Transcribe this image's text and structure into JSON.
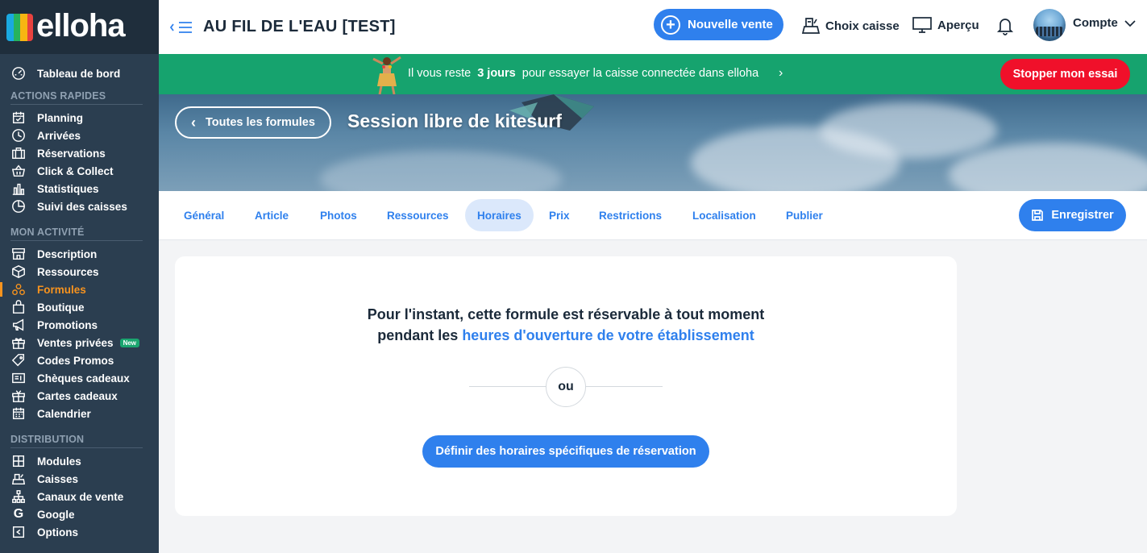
{
  "brand": {
    "logo_text": "elloha",
    "logo_colors": [
      "#1aa9e1",
      "#27b35e",
      "#f7b512",
      "#e8423f"
    ]
  },
  "sidebar": {
    "dashboard": "Tableau de bord",
    "sections": [
      {
        "title": "ACTIONS RAPIDES",
        "items": [
          {
            "label": "Planning",
            "icon": "calendar-check-icon"
          },
          {
            "label": "Arrivées",
            "icon": "clock-icon"
          },
          {
            "label": "Réservations",
            "icon": "suitcase-icon"
          },
          {
            "label": "Click & Collect",
            "icon": "basket-icon"
          },
          {
            "label": "Statistiques",
            "icon": "bar-chart-icon"
          },
          {
            "label": "Suivi des caisses",
            "icon": "pie-chart-icon"
          }
        ]
      },
      {
        "title": "MON ACTIVITÉ",
        "items": [
          {
            "label": "Description",
            "icon": "storefront-icon"
          },
          {
            "label": "Ressources",
            "icon": "box-icon"
          },
          {
            "label": "Formules",
            "icon": "bikes-icon",
            "active": true
          },
          {
            "label": "Boutique",
            "icon": "shopping-bag-icon"
          },
          {
            "label": "Promotions",
            "icon": "megaphone-icon"
          },
          {
            "label": "Ventes privées",
            "icon": "gift-icon",
            "badge": "New"
          },
          {
            "label": "Codes Promos",
            "icon": "tag-icon"
          },
          {
            "label": "Chèques cadeaux",
            "icon": "voucher-icon"
          },
          {
            "label": "Cartes cadeaux",
            "icon": "gift-card-icon"
          },
          {
            "label": "Calendrier",
            "icon": "calendar-icon"
          }
        ]
      },
      {
        "title": "DISTRIBUTION",
        "items": [
          {
            "label": "Modules",
            "icon": "grid-icon"
          },
          {
            "label": "Caisses",
            "icon": "cash-register-icon"
          },
          {
            "label": "Canaux de vente",
            "icon": "network-icon"
          },
          {
            "label": "Google",
            "icon": "google-icon"
          },
          {
            "label": "Options",
            "icon": "options-icon"
          }
        ]
      }
    ]
  },
  "topbar": {
    "establishment": "AU FIL DE L'EAU [TEST]",
    "new_sale": "Nouvelle vente",
    "choose_register": "Choix caisse",
    "preview": "Aperçu",
    "account": "Compte"
  },
  "banner": {
    "prefix": "Il vous reste",
    "days": "3 jours",
    "suffix": "pour essayer la caisse connectée dans elloha",
    "stop": "Stopper mon essai"
  },
  "hero": {
    "back": "Toutes les formules",
    "title": "Session libre de kitesurf"
  },
  "tabs": {
    "items": [
      "Général",
      "Article",
      "Photos",
      "Ressources",
      "Horaires",
      "Prix",
      "Restrictions",
      "Localisation",
      "Publier"
    ],
    "active": "Horaires",
    "save": "Enregistrer"
  },
  "card": {
    "line1": "Pour l'instant, cette formule est réservable à tout moment",
    "line2_prefix": "pendant les",
    "line2_link": "heures d'ouverture de votre établissement",
    "or": "ou",
    "define": "Définir des horaires spécifiques de réservation"
  }
}
